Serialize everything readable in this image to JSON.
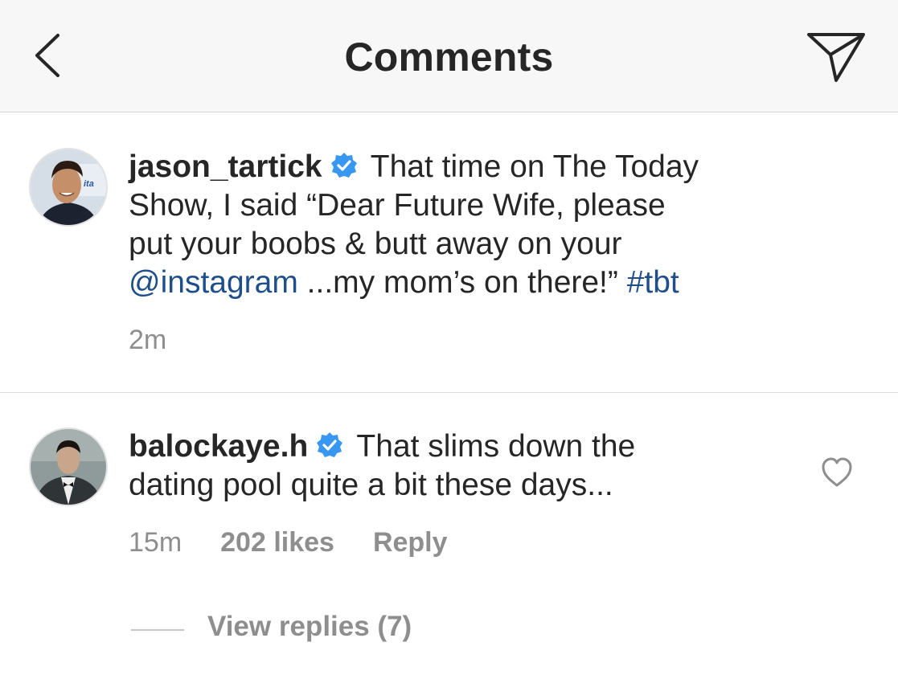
{
  "header": {
    "title": "Comments",
    "back_icon": "chevron-left-icon",
    "share_icon": "paper-plane-icon"
  },
  "caption": {
    "username": "jason_tartick",
    "verified": true,
    "text_part1": " That time on The Today",
    "text_line2": "Show, I said “Dear Future Wife, please",
    "text_line3": "put your boobs & butt away on your",
    "mention": "@instagram",
    "text_part4": " ...my mom’s on there!” ",
    "hashtag": "#tbt",
    "time": "2m"
  },
  "comments": [
    {
      "username": "balockaye.h",
      "verified": true,
      "text_line1": " That slims down the",
      "text_line2": "dating pool quite a bit these days...",
      "time": "15m",
      "likes": "202 likes",
      "reply_label": "Reply",
      "view_replies": "View replies (7)"
    }
  ],
  "colors": {
    "header_bg": "#f7f7f7",
    "text": "#262626",
    "secondary": "#8e8e8e",
    "link": "#1e4f8a",
    "verified_badge": "#3897f0"
  }
}
